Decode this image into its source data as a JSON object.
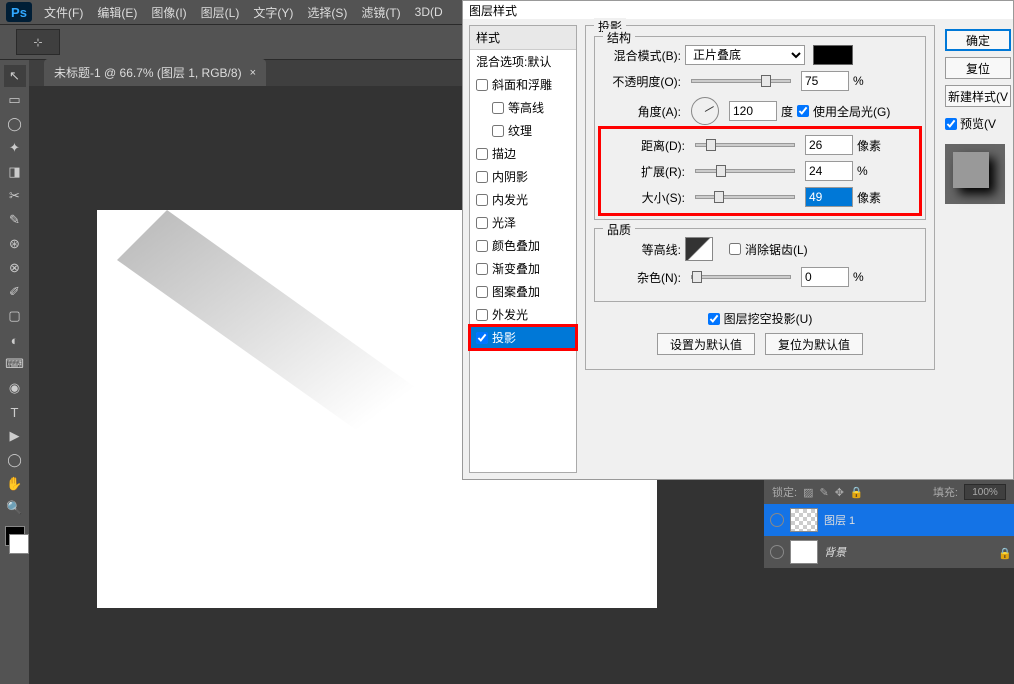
{
  "menubar": {
    "items": [
      "文件(F)",
      "编辑(E)",
      "图像(I)",
      "图层(L)",
      "文字(Y)",
      "选择(S)",
      "滤镜(T)",
      "3D(D"
    ]
  },
  "doc_tab": {
    "title": "未标题-1 @ 66.7% (图层 1, RGB/8)",
    "close": "×"
  },
  "tool_preset_icon": "⊹",
  "dialog": {
    "title": "图层样式",
    "styles_header": "样式",
    "blend_options": "混合选项:默认",
    "items": [
      {
        "label": "斜面和浮雕",
        "checked": false
      },
      {
        "label": "等高线",
        "indent": true
      },
      {
        "label": "纹理",
        "indent": true
      },
      {
        "label": "描边",
        "checked": false
      },
      {
        "label": "内阴影",
        "checked": false
      },
      {
        "label": "内发光",
        "checked": false
      },
      {
        "label": "光泽",
        "checked": false
      },
      {
        "label": "颜色叠加",
        "checked": false
      },
      {
        "label": "渐变叠加",
        "checked": false
      },
      {
        "label": "图案叠加",
        "checked": false
      },
      {
        "label": "外发光",
        "checked": false
      },
      {
        "label": "投影",
        "checked": true,
        "selected": true
      }
    ],
    "drop_shadow": {
      "section": "投影",
      "structure": "结构",
      "blend_mode_label": "混合模式(B):",
      "blend_mode_value": "正片叠底",
      "opacity_label": "不透明度(O):",
      "opacity_value": "75",
      "opacity_unit": "%",
      "angle_label": "角度(A):",
      "angle_value": "120",
      "angle_unit": "度",
      "global_light": "使用全局光(G)",
      "distance_label": "距离(D):",
      "distance_value": "26",
      "distance_unit": "像素",
      "spread_label": "扩展(R):",
      "spread_value": "24",
      "spread_unit": "%",
      "size_label": "大小(S):",
      "size_value": "49",
      "size_unit": "像素",
      "quality": "品质",
      "contour_label": "等高线:",
      "antialias": "消除锯齿(L)",
      "noise_label": "杂色(N):",
      "noise_value": "0",
      "noise_unit": "%",
      "knockout": "图层挖空投影(U)",
      "make_default": "设置为默认值",
      "reset_default": "复位为默认值"
    },
    "buttons": {
      "ok": "确定",
      "cancel": "复位",
      "new_style": "新建样式(V",
      "preview": "预览(V"
    }
  },
  "layers": {
    "lock_label": "锁定:",
    "fill_label": "填充:",
    "fill_value": "100%",
    "items": [
      {
        "name": "图层 1",
        "active": true
      },
      {
        "name": "背景",
        "locked": true
      }
    ]
  },
  "tools": [
    "↖",
    "▭",
    "◯",
    "✦",
    "◨",
    "✂",
    "✎",
    "⊛",
    "⊗",
    "✐",
    "▢",
    "◐",
    "⌨",
    "◉",
    "T",
    "▶",
    "◯",
    "✋",
    "🔍"
  ]
}
